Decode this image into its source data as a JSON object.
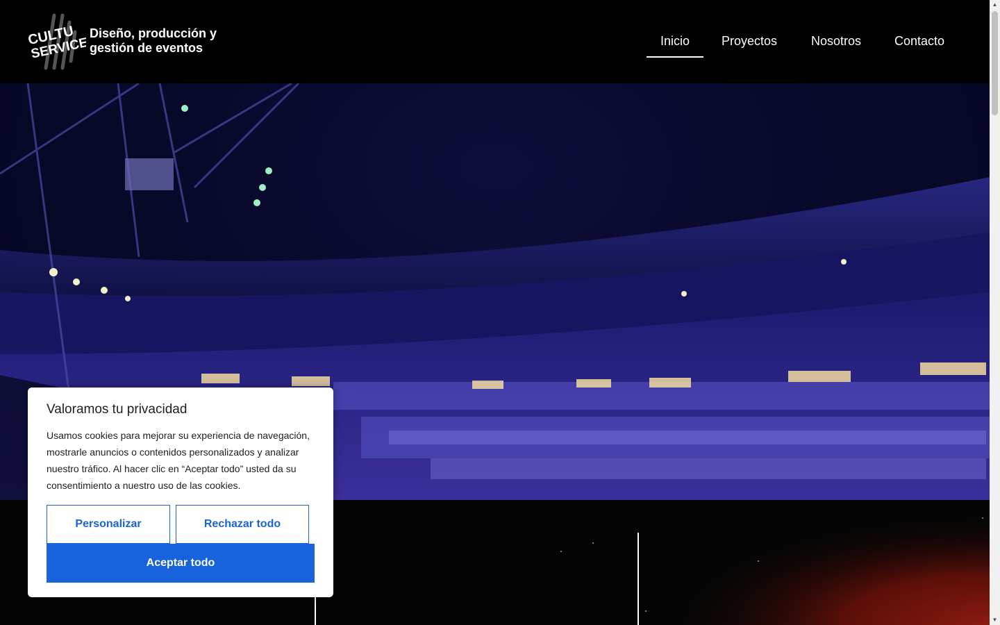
{
  "header": {
    "logo_line1": "CULTU",
    "logo_line2": "SERVICE",
    "tagline_line1": "Diseño, producción y",
    "tagline_line2": "gestión de eventos"
  },
  "nav": {
    "items": [
      {
        "label": "Inicio",
        "active": true
      },
      {
        "label": "Proyectos",
        "active": false
      },
      {
        "label": "Nosotros",
        "active": false
      },
      {
        "label": "Contacto",
        "active": false
      }
    ]
  },
  "hero": {
    "icon": "concert-arena-photo"
  },
  "cookie_banner": {
    "title": "Valoramos tu privacidad",
    "body": "Usamos cookies para mejorar su experiencia de navegación, mostrarle anuncios o contenidos personalizados y analizar nuestro tráfico. Al hacer clic en “Aceptar todo” usted da su consentimiento a nuestro uso de las cookies.",
    "customize_label": "Personalizar",
    "reject_label": "Rechazar todo",
    "accept_label": "Aceptar todo",
    "accent_color": "#1863dc"
  },
  "scrollbar": {
    "up_icon": "▲",
    "down_icon": "▼"
  }
}
